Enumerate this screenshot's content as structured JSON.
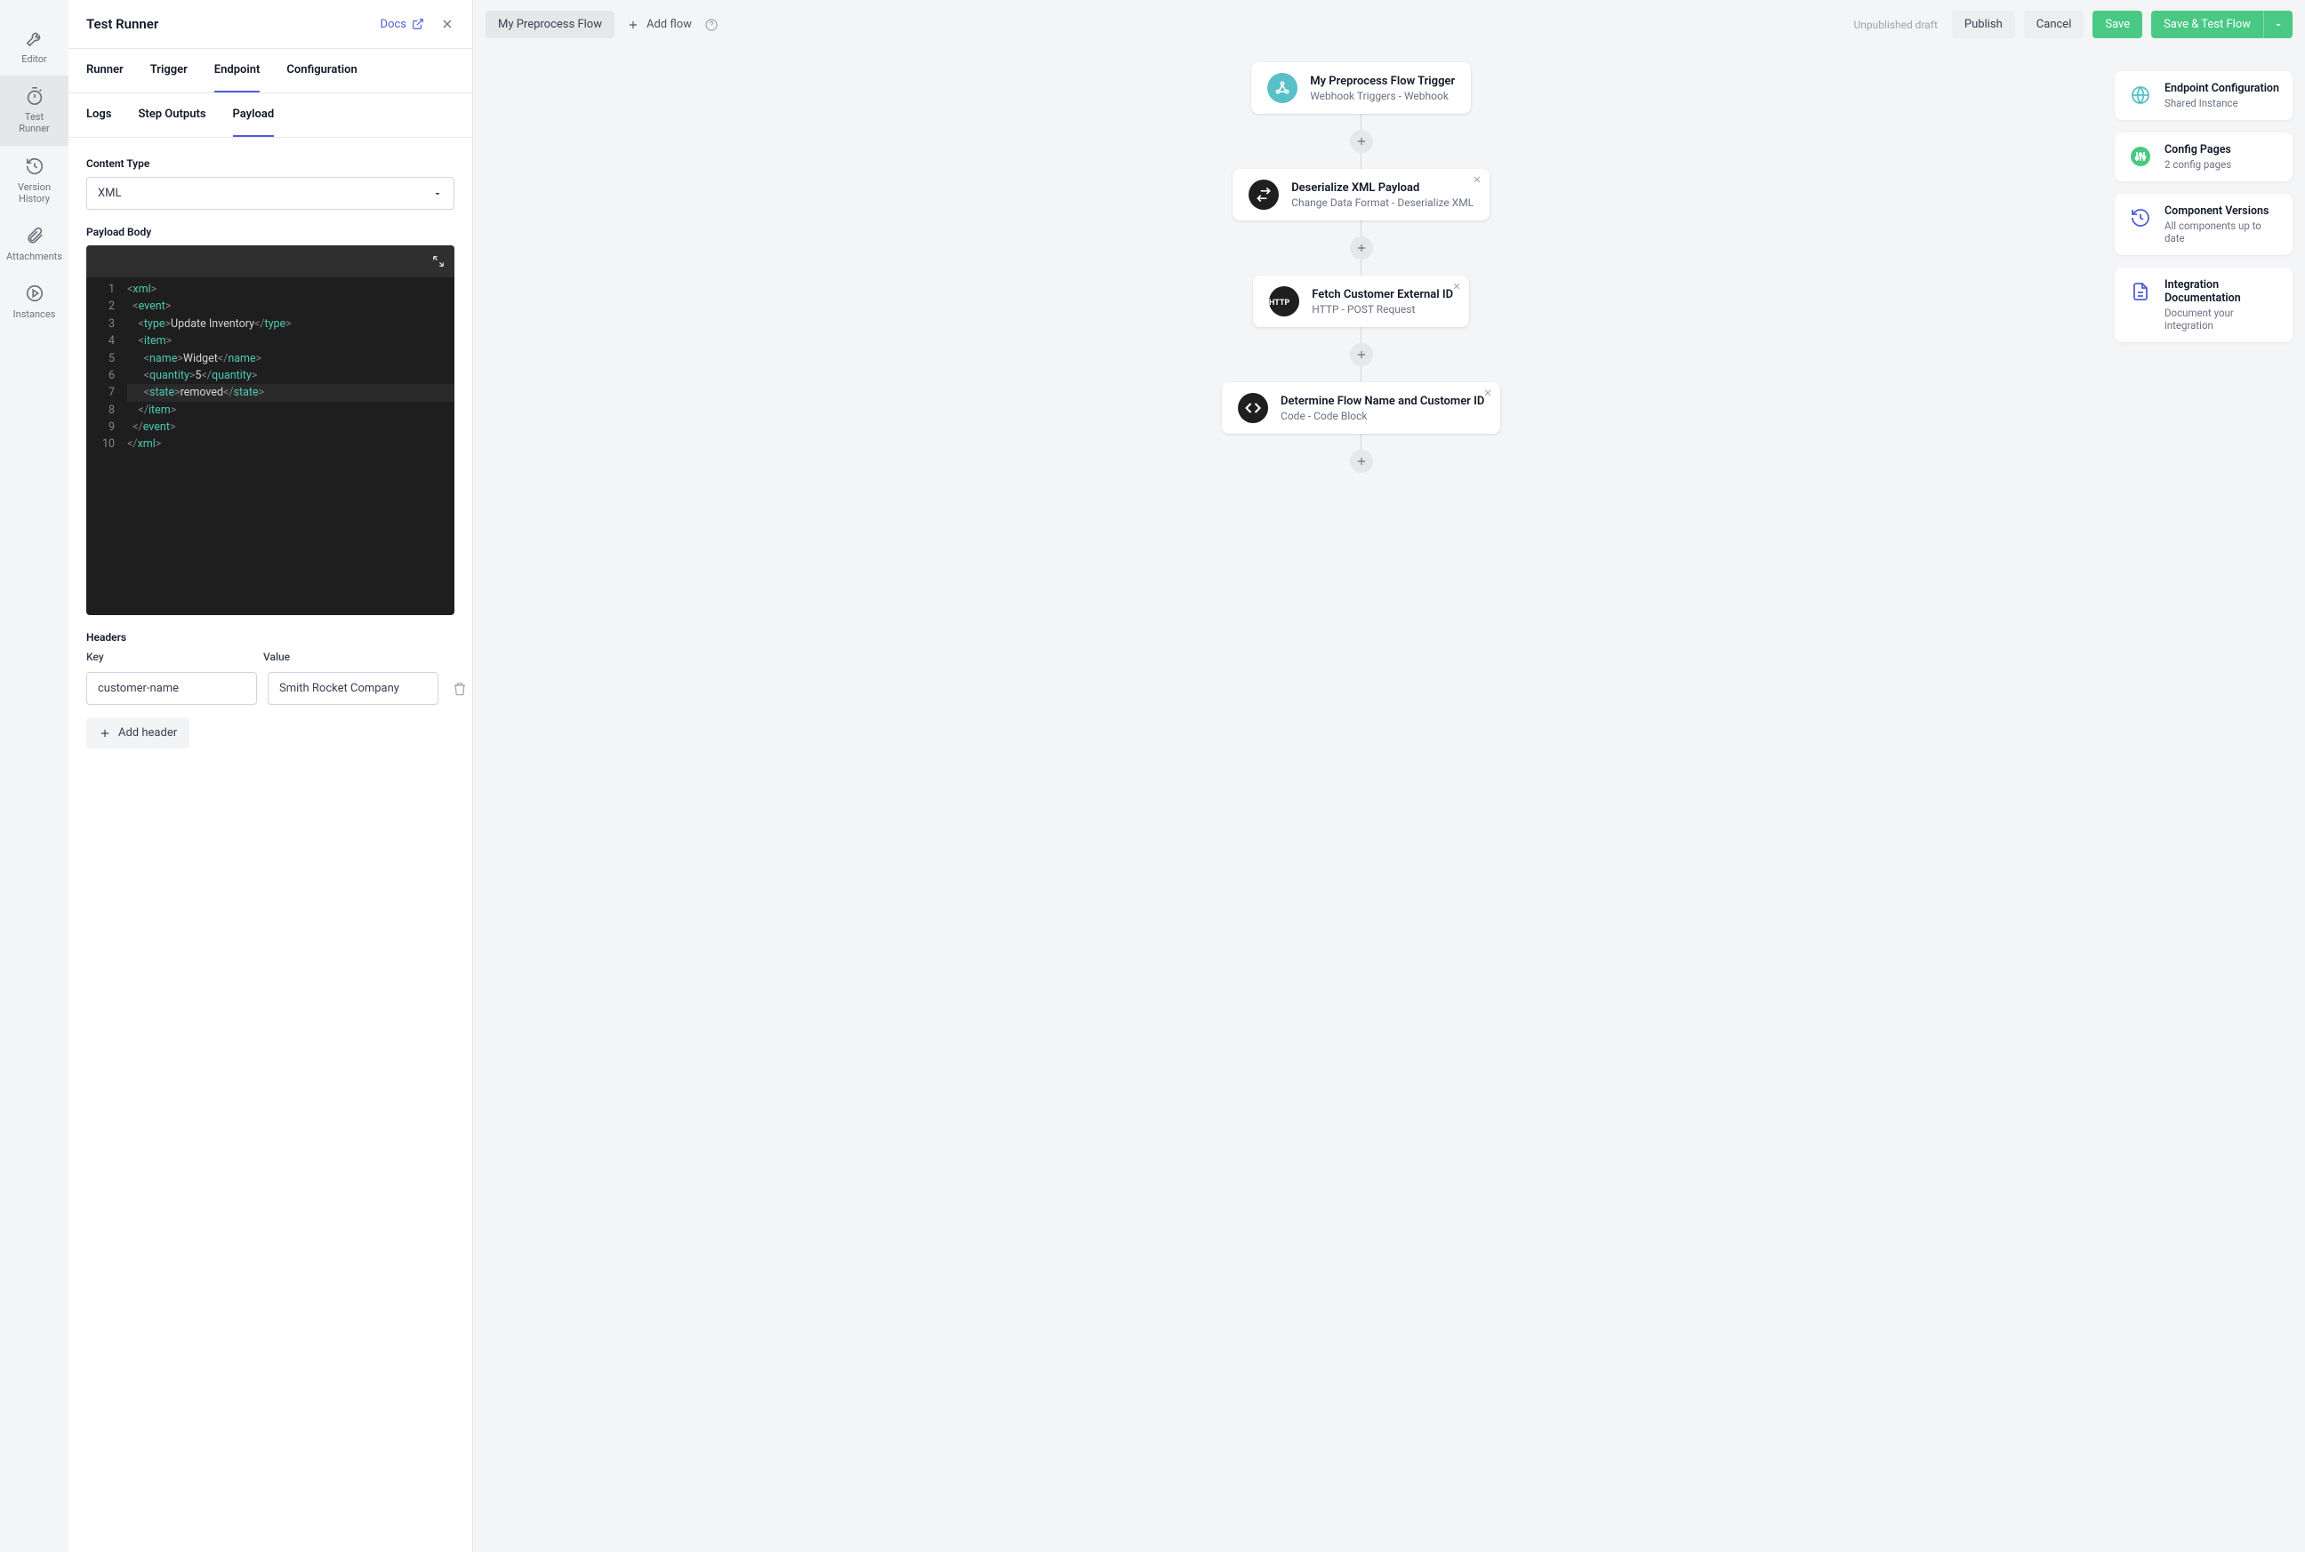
{
  "leftNav": {
    "items": [
      {
        "label": "Editor"
      },
      {
        "label": "Test\nRunner"
      },
      {
        "label": "Version\nHistory"
      },
      {
        "label": "Attachments"
      },
      {
        "label": "Instances"
      }
    ]
  },
  "panel": {
    "title": "Test Runner",
    "docs": "Docs",
    "tabs": [
      "Runner",
      "Trigger",
      "Endpoint",
      "Configuration"
    ],
    "activeTab": 2,
    "subTabs": [
      "Logs",
      "Step Outputs",
      "Payload"
    ],
    "activeSubTab": 2,
    "contentTypeLabel": "Content Type",
    "contentTypeValue": "XML",
    "payloadBodyLabel": "Payload Body",
    "code": {
      "lines": [
        {
          "indent": 0,
          "open": "xml",
          "text": "",
          "closing": false,
          "selfclose": false
        },
        {
          "indent": 1,
          "open": "event",
          "text": "",
          "closing": false
        },
        {
          "indent": 2,
          "open": "type",
          "text": "Update Inventory",
          "close": "type"
        },
        {
          "indent": 2,
          "open": "item",
          "text": "",
          "closing": false
        },
        {
          "indent": 3,
          "open": "name",
          "text": "Widget",
          "close": "name"
        },
        {
          "indent": 3,
          "open": "quantity",
          "text": "5",
          "close": "quantity"
        },
        {
          "indent": 3,
          "open": "state",
          "text": "removed",
          "close": "state",
          "hl": true
        },
        {
          "indent": 2,
          "closeonly": "item"
        },
        {
          "indent": 1,
          "closeonly": "event"
        },
        {
          "indent": 0,
          "closeonly": "xml"
        }
      ]
    },
    "headersLabel": "Headers",
    "keyLabel": "Key",
    "valueLabel": "Value",
    "headers": [
      {
        "key": "customer-name",
        "value": "Smith Rocket Company"
      }
    ],
    "addHeader": "Add header"
  },
  "topbar": {
    "flowName": "My Preprocess Flow",
    "addFlow": "Add flow",
    "draft": "Unpublished draft",
    "publish": "Publish",
    "cancel": "Cancel",
    "save": "Save",
    "saveTest": "Save & Test Flow"
  },
  "flow": [
    {
      "title": "My Preprocess Flow Trigger",
      "sub": "Webhook Triggers - Webhook",
      "icon": "webhook",
      "iconBg": "#58c0c6",
      "close": false
    },
    {
      "title": "Deserialize XML Payload",
      "sub": "Change Data Format - Deserialize XML",
      "icon": "swap",
      "iconBg": "#1f1f1f",
      "close": true
    },
    {
      "title": "Fetch Customer External ID",
      "sub": "HTTP - POST Request",
      "icon": "http",
      "iconBg": "#1f1f1f",
      "close": true
    },
    {
      "title": "Determine Flow Name and Customer ID",
      "sub": "Code - Code Block",
      "icon": "code",
      "iconBg": "#1f1f1f",
      "close": true
    }
  ],
  "infoCards": [
    {
      "title": "Endpoint Configuration",
      "sub": "Shared Instance",
      "icon": "globe",
      "color": "#58c0c6"
    },
    {
      "title": "Config Pages",
      "sub": "2 config pages",
      "icon": "sliders",
      "color": "#4ac984"
    },
    {
      "title": "Component Versions",
      "sub": "All components up to date",
      "icon": "history",
      "color": "#4f5dd8"
    },
    {
      "title": "Integration Documentation",
      "sub": "Document your integration",
      "icon": "doc",
      "color": "#4f5dd8"
    }
  ]
}
